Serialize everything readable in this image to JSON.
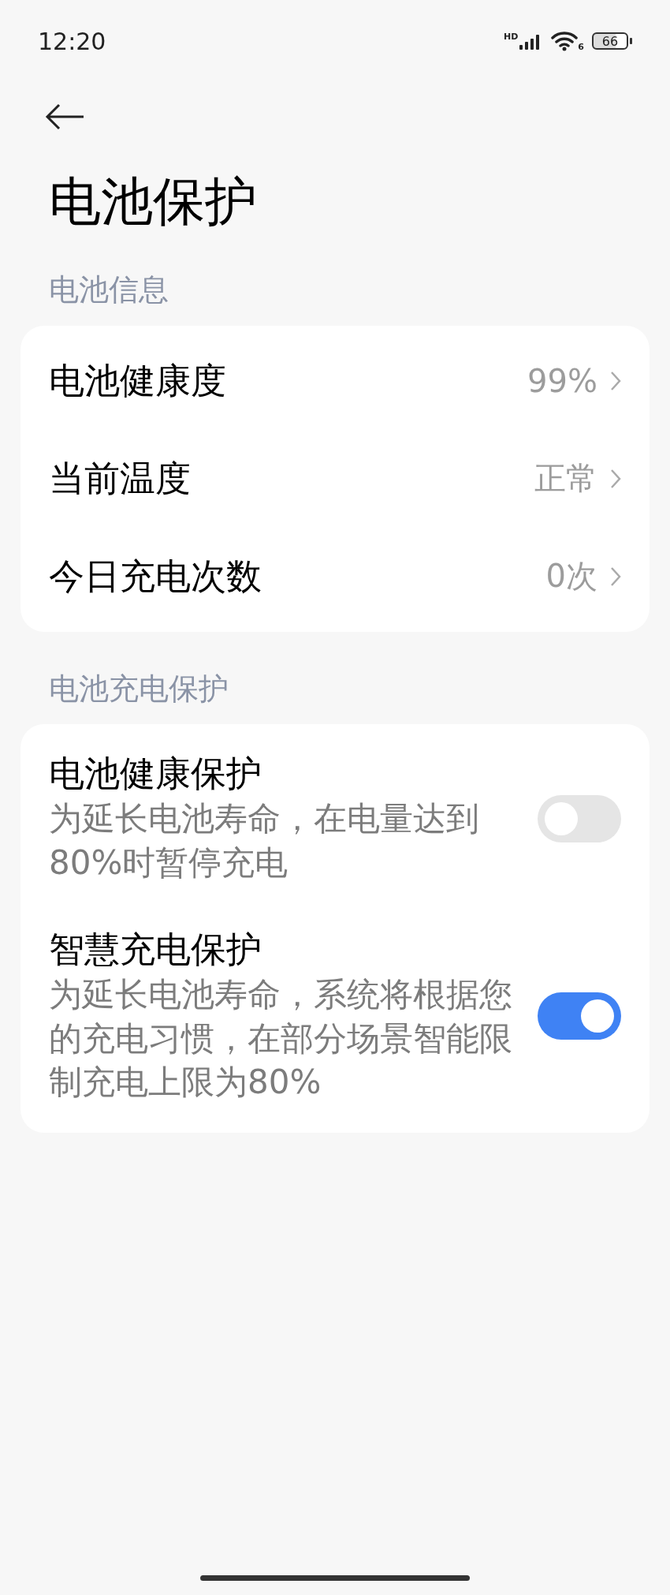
{
  "status_bar": {
    "time": "12:20",
    "network_label": "HD",
    "wifi_label": "6",
    "battery": "66"
  },
  "title": "电池保护",
  "sections": [
    {
      "header": "电池信息",
      "items": [
        {
          "kind": "nav",
          "label": "电池健康度",
          "value": "99%"
        },
        {
          "kind": "nav",
          "label": "当前温度",
          "value": "正常"
        },
        {
          "kind": "nav",
          "label": "今日充电次数",
          "value": "0次"
        }
      ]
    },
    {
      "header": "电池充电保护",
      "items": [
        {
          "kind": "toggle",
          "label": "电池健康保护",
          "description": "为延长电池寿命，在电量达到80%时暂停充电",
          "on": false
        },
        {
          "kind": "toggle",
          "label": "智慧充电保护",
          "description": "为延长电池寿命，系统将根据您的充电习惯，在部分场景智能限制充电上限为80%",
          "on": true
        }
      ]
    }
  ]
}
